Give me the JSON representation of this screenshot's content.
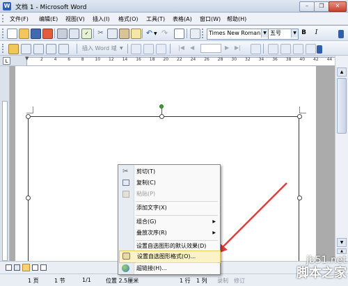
{
  "window": {
    "title": "文档 1 - Microsoft Word"
  },
  "menu": {
    "items": [
      "文件(F)",
      "编辑(E)",
      "视图(V)",
      "插入(I)",
      "格式(O)",
      "工具(T)",
      "表格(A)",
      "窗口(W)",
      "帮助(H)"
    ]
  },
  "format_toolbar": {
    "font": "Times New Roman",
    "size": "五号",
    "bold": "B",
    "italic": "I"
  },
  "drawing_toolbar": {
    "insert_word": "插入 Word 域"
  },
  "ruler": {
    "numbers": [
      "2",
      "4",
      "6",
      "8",
      "10",
      "12",
      "14",
      "16",
      "18",
      "20",
      "22",
      "24",
      "26",
      "28",
      "30",
      "32",
      "34",
      "36",
      "38",
      "40",
      "42",
      "44"
    ],
    "marker": "L"
  },
  "context_menu": {
    "items": [
      {
        "label": "剪切(T)",
        "icon": "scissors-icon",
        "state": "normal"
      },
      {
        "label": "复制(C)",
        "icon": "copy-icon",
        "state": "normal"
      },
      {
        "label": "粘贴(P)",
        "icon": "paste-icon",
        "state": "disabled"
      },
      {
        "label": "添加文字(X)",
        "icon": "",
        "state": "normal"
      },
      {
        "label": "组合(G)",
        "icon": "",
        "state": "submenu"
      },
      {
        "label": "叠放次序(R)",
        "icon": "",
        "state": "submenu"
      },
      {
        "label": "设置自选图形的默认效果(D)",
        "icon": "",
        "state": "normal"
      },
      {
        "label": "设置自选图形格式(O)...",
        "icon": "format-shape-icon",
        "state": "highlighted"
      },
      {
        "label": "超链接(H)...",
        "icon": "hyperlink-icon",
        "state": "normal"
      }
    ]
  },
  "status": {
    "page": "1 页",
    "section": "1 节",
    "pages": "1/1",
    "position": "位置 2.5厘米",
    "line": "1 行",
    "col": "1 列",
    "rec": "录制",
    "trk": "修订"
  },
  "watermark": {
    "line1": "jb51.net",
    "line2": "脚本之家"
  },
  "colors": {
    "accent": "#E23B3B",
    "highlight": "#FBF2C7",
    "rotate_handle": "#35A82B"
  }
}
